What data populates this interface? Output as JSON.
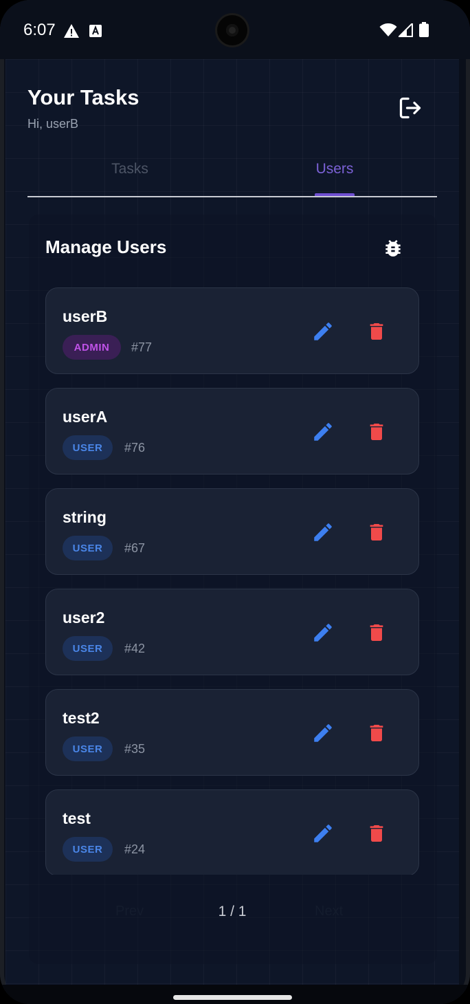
{
  "status_bar": {
    "time": "6:07",
    "icons": [
      "warning-icon",
      "a-icon",
      "wifi-icon",
      "signal-icon",
      "battery-icon"
    ]
  },
  "header": {
    "title": "Your Tasks",
    "greeting": "Hi, userB",
    "logout_icon": "logout-icon"
  },
  "tabs": [
    {
      "label": "Tasks",
      "active": false
    },
    {
      "label": "Users",
      "active": true
    }
  ],
  "manage_users": {
    "title": "Manage Users",
    "debug_icon": "bug-icon",
    "users": [
      {
        "name": "userB",
        "role": "ADMIN",
        "id": "#77"
      },
      {
        "name": "userA",
        "role": "USER",
        "id": "#76"
      },
      {
        "name": "string",
        "role": "USER",
        "id": "#67"
      },
      {
        "name": "user2",
        "role": "USER",
        "id": "#42"
      },
      {
        "name": "test2",
        "role": "USER",
        "id": "#35"
      },
      {
        "name": "test",
        "role": "USER",
        "id": "#24"
      }
    ]
  },
  "pagination": {
    "prev_label": "Prev",
    "text": "1 / 1",
    "next_label": "Next"
  },
  "colors": {
    "background": "#0e1628",
    "card": "#1a2234",
    "accent": "#6f4fd1",
    "edit": "#3d7ff0",
    "delete": "#f04a4a",
    "user_badge": "#4a86e8",
    "admin_badge": "#c052e8"
  }
}
